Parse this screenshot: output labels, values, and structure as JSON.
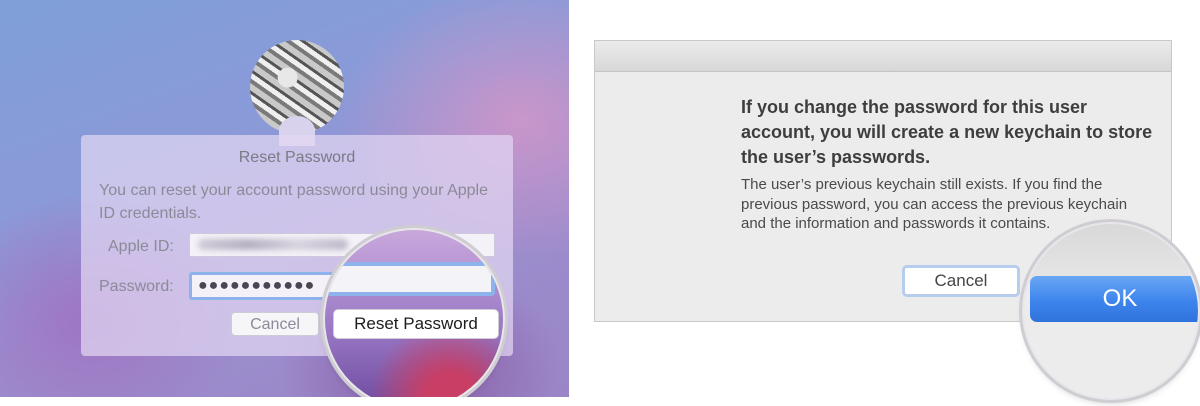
{
  "reset_dialog": {
    "title": "Reset Password",
    "message": "You can reset your account password using your Apple ID credentials.",
    "apple_id_label": "Apple ID:",
    "password_label": "Password:",
    "password_value": "●●●●●●●●●●●",
    "cancel_label": "Cancel",
    "reset_label": "Reset Password"
  },
  "keychain_alert": {
    "heading": "If you change the password for this user account, you will create a new keychain to store the user’s passwords.",
    "body": "The user’s previous keychain still exists. If you find the previous password, you can access the previous keychain and the information and passwords it contains.",
    "cancel_label": "Cancel",
    "ok_label": "OK"
  },
  "colors": {
    "ok_button": "#3d84ec",
    "focus_ring": "#8db2ec",
    "background_gradient": "#8a9ad8"
  },
  "icons": {
    "avatar": "user-avatar-photo"
  }
}
